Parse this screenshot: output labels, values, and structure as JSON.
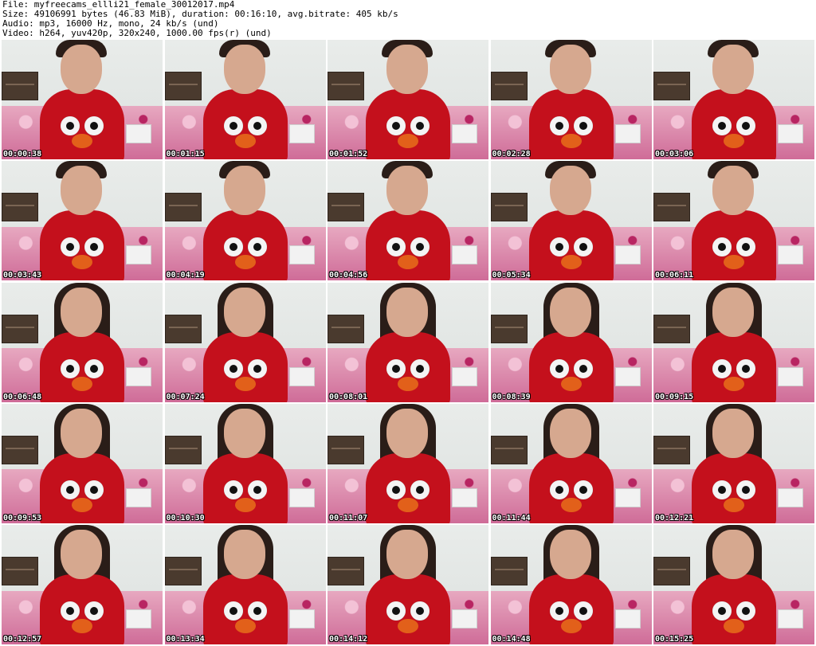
{
  "header": {
    "file": "File: myfreecams_ellli21_female_30012017.mp4",
    "size": "Size: 49106991 bytes (46.83 MiB), duration: 00:16:10, avg.bitrate: 405 kb/s",
    "audio": "Audio: mp3, 16000 Hz, mono, 24 kb/s (und)",
    "video": "Video: h264, yuv420p, 320x240, 1000.00 fps(r) (und)"
  },
  "thumbnails": [
    {
      "timestamp": "00:00:38",
      "long_hair": false
    },
    {
      "timestamp": "00:01:15",
      "long_hair": false
    },
    {
      "timestamp": "00:01:52",
      "long_hair": false
    },
    {
      "timestamp": "00:02:28",
      "long_hair": false
    },
    {
      "timestamp": "00:03:06",
      "long_hair": false
    },
    {
      "timestamp": "00:03:43",
      "long_hair": false
    },
    {
      "timestamp": "00:04:19",
      "long_hair": false
    },
    {
      "timestamp": "00:04:56",
      "long_hair": false
    },
    {
      "timestamp": "00:05:34",
      "long_hair": false
    },
    {
      "timestamp": "00:06:11",
      "long_hair": false
    },
    {
      "timestamp": "00:06:48",
      "long_hair": true
    },
    {
      "timestamp": "00:07:24",
      "long_hair": true
    },
    {
      "timestamp": "00:08:01",
      "long_hair": true
    },
    {
      "timestamp": "00:08:39",
      "long_hair": true
    },
    {
      "timestamp": "00:09:15",
      "long_hair": true
    },
    {
      "timestamp": "00:09:53",
      "long_hair": true
    },
    {
      "timestamp": "00:10:30",
      "long_hair": true
    },
    {
      "timestamp": "00:11:07",
      "long_hair": true
    },
    {
      "timestamp": "00:11:44",
      "long_hair": true
    },
    {
      "timestamp": "00:12:21",
      "long_hair": true
    },
    {
      "timestamp": "00:12:57",
      "long_hair": true
    },
    {
      "timestamp": "00:13:34",
      "long_hair": true
    },
    {
      "timestamp": "00:14:12",
      "long_hair": true
    },
    {
      "timestamp": "00:14:48",
      "long_hair": true
    },
    {
      "timestamp": "00:15:25",
      "long_hair": true
    }
  ]
}
